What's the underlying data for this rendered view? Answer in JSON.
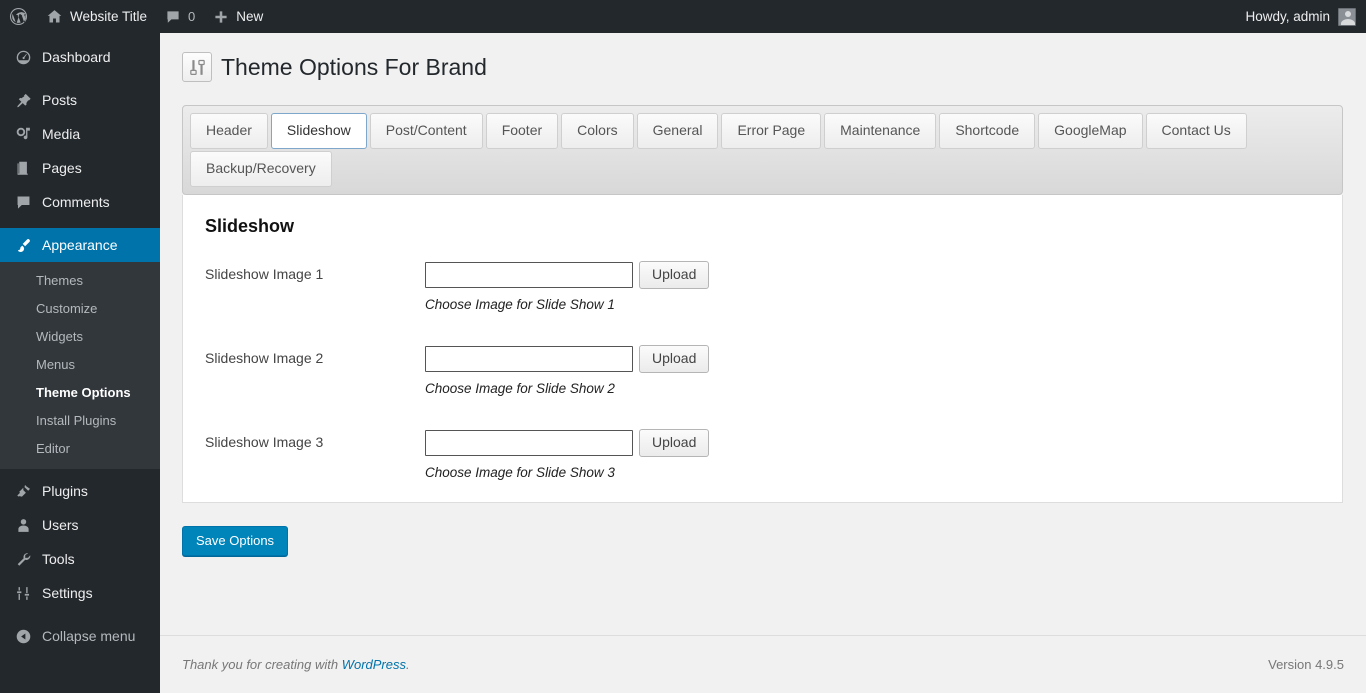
{
  "adminbar": {
    "wp_logo_icon": "wordpress-logo-icon",
    "site_home_icon": "home-icon",
    "site_title": "Website Title",
    "comments_icon": "comment-bubble-icon",
    "comments_count": "0",
    "new_icon": "plus-icon",
    "new_label": "New",
    "howdy": "Howdy, admin",
    "avatar_icon": "user-avatar-icon"
  },
  "sidebar": {
    "items": [
      {
        "label": "Dashboard",
        "icon": "dashboard-icon",
        "current": false
      },
      {
        "label": "Posts",
        "icon": "pin-icon",
        "current": false
      },
      {
        "label": "Media",
        "icon": "media-icon",
        "current": false
      },
      {
        "label": "Pages",
        "icon": "page-icon",
        "current": false
      },
      {
        "label": "Comments",
        "icon": "comment-bubble-icon",
        "current": false
      },
      {
        "label": "Appearance",
        "icon": "paintbrush-icon",
        "current": true
      },
      {
        "label": "Plugins",
        "icon": "plug-icon",
        "current": false
      },
      {
        "label": "Users",
        "icon": "user-icon",
        "current": false
      },
      {
        "label": "Tools",
        "icon": "wrench-icon",
        "current": false
      },
      {
        "label": "Settings",
        "icon": "sliders-icon",
        "current": false
      },
      {
        "label": "Collapse menu",
        "icon": "collapse-arrow-icon",
        "current": false
      }
    ],
    "appearance_submenu": [
      {
        "label": "Themes",
        "current": false
      },
      {
        "label": "Customize",
        "current": false
      },
      {
        "label": "Widgets",
        "current": false
      },
      {
        "label": "Menus",
        "current": false
      },
      {
        "label": "Theme Options",
        "current": true
      },
      {
        "label": "Install Plugins",
        "current": false
      },
      {
        "label": "Editor",
        "current": false
      }
    ]
  },
  "page": {
    "title": "Theme Options For Brand",
    "title_icon": "sliders-settings-icon"
  },
  "tabs": [
    {
      "label": "Header",
      "active": false
    },
    {
      "label": "Slideshow",
      "active": true
    },
    {
      "label": "Post/Content",
      "active": false
    },
    {
      "label": "Footer",
      "active": false
    },
    {
      "label": "Colors",
      "active": false
    },
    {
      "label": "General",
      "active": false
    },
    {
      "label": "Error Page",
      "active": false
    },
    {
      "label": "Maintenance",
      "active": false
    },
    {
      "label": "Shortcode",
      "active": false
    },
    {
      "label": "GoogleMap",
      "active": false
    },
    {
      "label": "Contact Us",
      "active": false
    },
    {
      "label": "Backup/Recovery",
      "active": false
    }
  ],
  "section": {
    "heading": "Slideshow",
    "fields": [
      {
        "label": "Slideshow Image 1",
        "value": "",
        "placeholder": "",
        "button": "Upload",
        "description": "Choose Image for Slide Show 1"
      },
      {
        "label": "Slideshow Image 2",
        "value": "",
        "placeholder": "",
        "button": "Upload",
        "description": "Choose Image for Slide Show 2"
      },
      {
        "label": "Slideshow Image 3",
        "value": "",
        "placeholder": "",
        "button": "Upload",
        "description": "Choose Image for Slide Show 3"
      }
    ]
  },
  "actions": {
    "save_label": "Save Options"
  },
  "footer": {
    "thanks_prefix": "Thank you for creating with ",
    "link_label": "WordPress",
    "thanks_suffix": ".",
    "version": "Version 4.9.5"
  },
  "colors": {
    "accent": "#0073aa",
    "primary_button": "#0085ba",
    "adminbar_bg": "#23282d",
    "submenu_bg": "#32373c",
    "active_tab_border": "#7fa7cc"
  }
}
